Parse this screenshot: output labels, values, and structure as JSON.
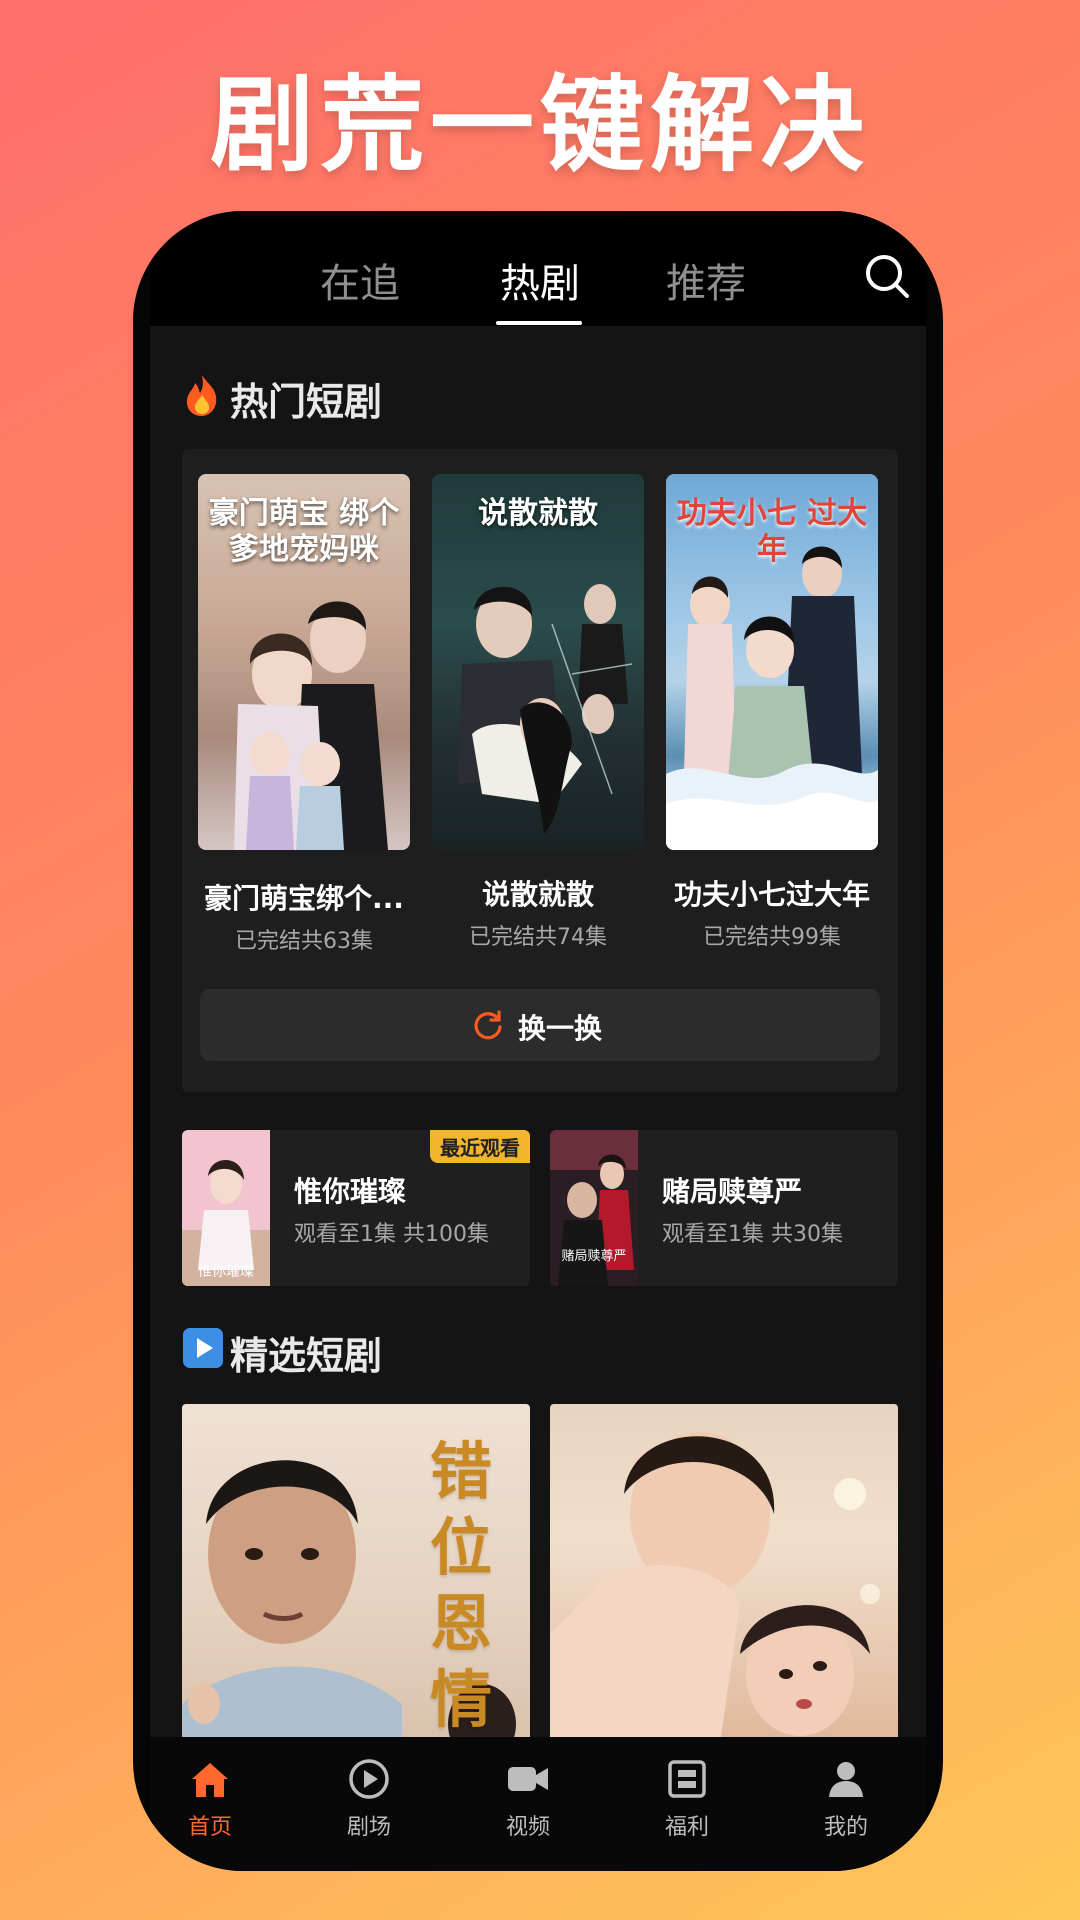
{
  "headline": "剧荒一键解决",
  "top_tabs": [
    {
      "label": "在追",
      "active": false
    },
    {
      "label": "热剧",
      "active": true
    },
    {
      "label": "推荐",
      "active": false
    }
  ],
  "search_icon": "search-icon",
  "hot_section": {
    "title": "热门短剧",
    "icon": "fire-icon",
    "dramas": [
      {
        "name": "豪门萌宝绑个...",
        "meta": "已完结共63集",
        "poster_text": "豪门萌宝 绑个爹地宠妈咪"
      },
      {
        "name": "说散就散",
        "meta": "已完结共74集",
        "poster_text": "说散就散"
      },
      {
        "name": "功夫小七过大年",
        "meta": "已完结共99集",
        "poster_text": "功夫小七 过大年"
      }
    ],
    "refresh_label": "换一换",
    "refresh_icon": "refresh-icon"
  },
  "recent": [
    {
      "title": "惟你璀璨",
      "progress": "观看至1集 共100集",
      "badge": "最近观看",
      "thumb_text": "惟你璀璨"
    },
    {
      "title": "赌局赎尊严",
      "progress": "观看至1集 共30集",
      "badge": "",
      "thumb_text": "赌局赎尊严"
    }
  ],
  "featured_section": {
    "title": "精选短剧",
    "icon": "play-square-icon",
    "cards": [
      {
        "poster_text": "错位恩情"
      },
      {
        "poster_text": ""
      }
    ]
  },
  "bottom_nav": [
    {
      "label": "首页",
      "icon": "home-icon",
      "active": true
    },
    {
      "label": "剧场",
      "icon": "play-circle-icon",
      "active": false
    },
    {
      "label": "视频",
      "icon": "video-camera-icon",
      "active": false
    },
    {
      "label": "福利",
      "icon": "gift-box-icon",
      "active": false
    },
    {
      "label": "我的",
      "icon": "user-icon",
      "active": false
    }
  ],
  "colors": {
    "accent": "#ff6a2c",
    "badge": "#f2b52c",
    "screen_bg": "#141414"
  }
}
